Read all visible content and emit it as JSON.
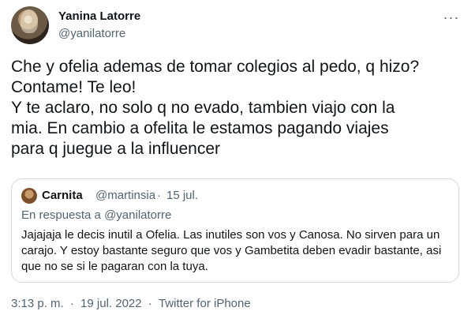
{
  "author": {
    "name": "Yanina Latorre",
    "handle": "@yanilatorre"
  },
  "more_icon": "more-horizontal-icon",
  "tweet_lines": [
    "Che y ofelia ademas de tomar colegios al pedo, q hizo?",
    "Contame! Te leo!",
    "Y te aclaro, no solo q no evado, tambien viajo con la",
    "mia. En cambio a ofelita le estamos pagando viajes",
    "para q juegue a la influencer"
  ],
  "quoted": {
    "name": "Carnita",
    "handle": "@martinsia",
    "separator": "·",
    "date": "15 jul.",
    "reply_prefix": "En respuesta a",
    "reply_to": "@yanilatorre",
    "lines": [
      "Jajajaja le decis inutil a Ofelia. Las inutiles son vos y Canosa. No sirven para un",
      "carajo. Y estoy bastante seguro que vos y Gambetita deben evadir bastante, asi",
      "que no se si le pagaran con la tuya."
    ]
  },
  "meta": {
    "time": "3:13 p. m.",
    "sep1": "·",
    "date": "19 jul. 2022",
    "sep2": "·",
    "source": "Twitter for iPhone"
  },
  "colors": {
    "text": "#0f1419",
    "secondary": "#536471",
    "border": "#cfd9de"
  }
}
